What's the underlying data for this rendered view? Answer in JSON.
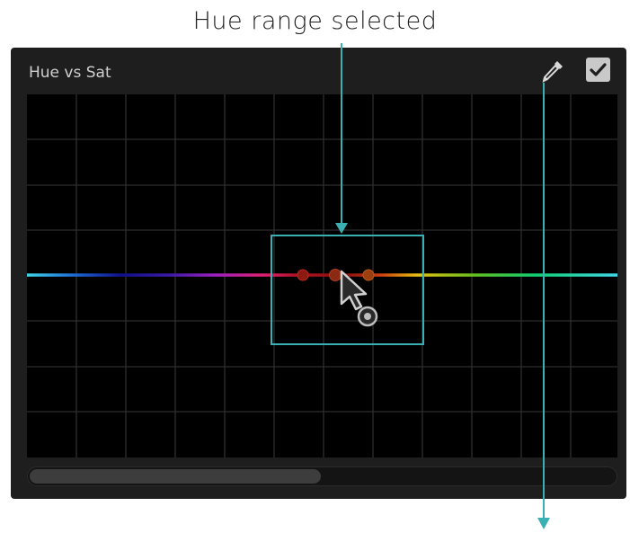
{
  "annotation": {
    "label": "Hue range selected"
  },
  "panel": {
    "title": "Hue vs Sat",
    "eyedropper_icon": "eyedropper-icon",
    "checkbox_checked": true
  },
  "colors": {
    "panel_bg": "#1e1e1e",
    "graph_bg": "#000000",
    "grid": "#2e2e2e",
    "highlight": "#3bb0b4",
    "control_point": "#8b1a12"
  },
  "curve": {
    "spectrum_stops": [
      "#3fd6e6",
      "#1d6ad6",
      "#10108a",
      "#3a1aa8",
      "#a020c0",
      "#e02070",
      "#b01020",
      "#8a1010",
      "#d04010",
      "#e8c010",
      "#60c020",
      "#10d070",
      "#3fd6e6"
    ]
  },
  "scrollbar": {
    "position": 0.5
  }
}
